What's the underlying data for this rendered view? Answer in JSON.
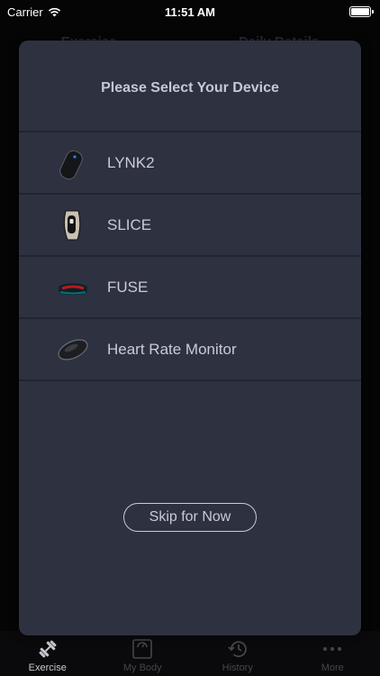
{
  "status_bar": {
    "carrier": "Carrier",
    "time": "11:51 AM"
  },
  "background": {
    "header_tabs": [
      "Exercise",
      "Daily Details"
    ],
    "tab_bar": [
      {
        "label": "Exercise",
        "icon": "dumbbell-icon",
        "active": true
      },
      {
        "label": "My Body",
        "icon": "scale-icon",
        "active": false
      },
      {
        "label": "History",
        "icon": "history-icon",
        "active": false
      },
      {
        "label": "More",
        "icon": "more-dots-icon",
        "active": false
      }
    ]
  },
  "modal": {
    "title": "Please Select Your Device",
    "devices": [
      {
        "label": "LYNK2",
        "icon": "lynk2-device-icon"
      },
      {
        "label": "SLICE",
        "icon": "slice-device-icon"
      },
      {
        "label": "FUSE",
        "icon": "fuse-device-icon"
      },
      {
        "label": "Heart Rate Monitor",
        "icon": "heart-rate-monitor-icon"
      }
    ],
    "skip_label": "Skip for Now"
  }
}
